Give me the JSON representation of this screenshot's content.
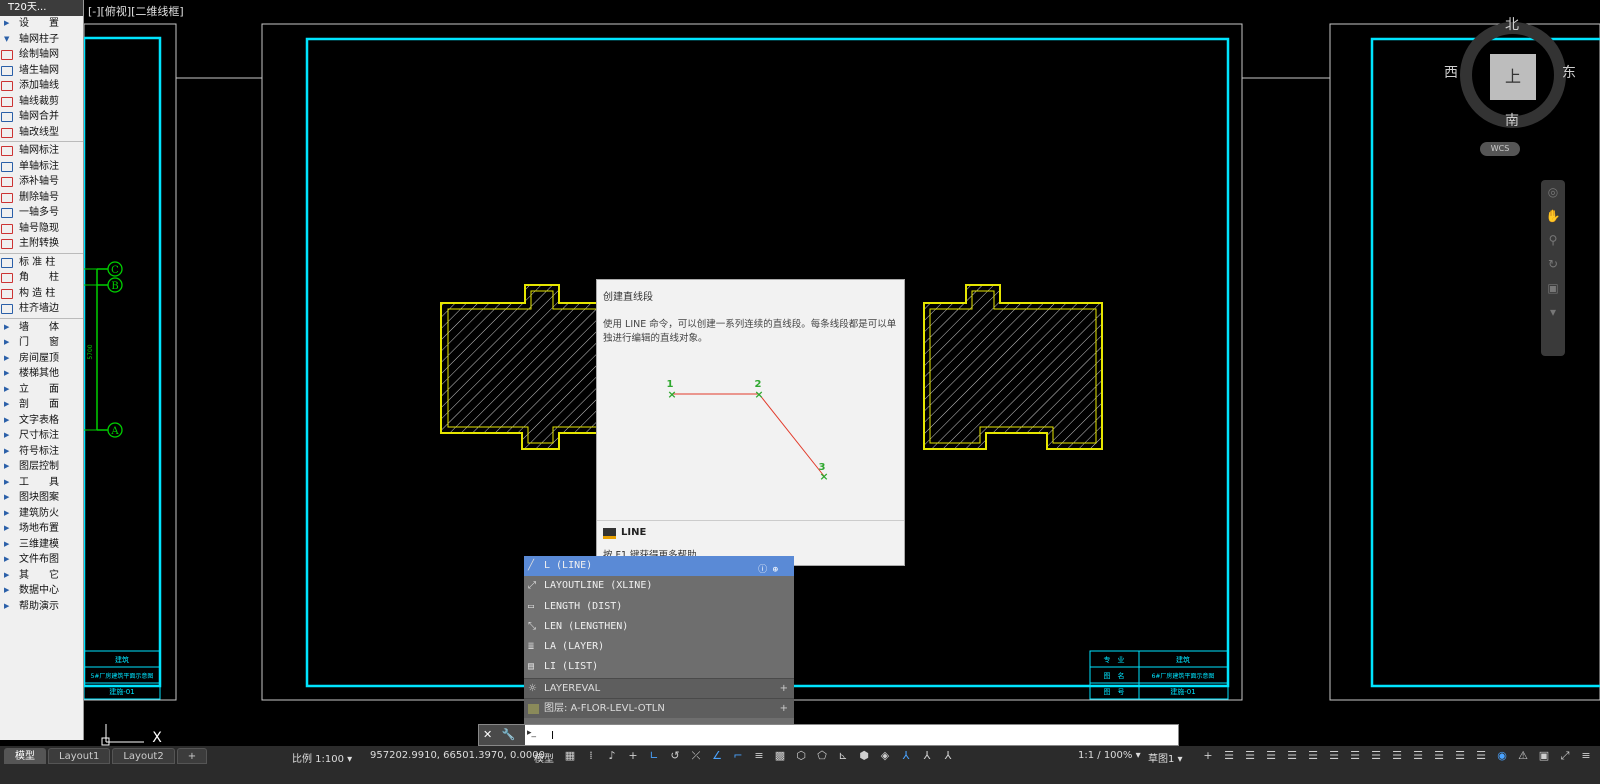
{
  "viewport": {
    "label": "[-][俯视][二维线框]"
  },
  "side_menu": {
    "title": "T20天...",
    "items": [
      {
        "label": "设　　置",
        "type": "group"
      },
      {
        "label": "轴网柱子",
        "type": "group-open"
      },
      {
        "label": "绘制轴网",
        "type": "sub"
      },
      {
        "label": "墙生轴网",
        "type": "sub"
      },
      {
        "label": "添加轴线",
        "type": "sub"
      },
      {
        "label": "轴线裁剪",
        "type": "sub"
      },
      {
        "label": "轴网合并",
        "type": "sub"
      },
      {
        "label": "轴改线型",
        "type": "sub"
      },
      {
        "label": "轴网标注",
        "type": "sub"
      },
      {
        "label": "单轴标注",
        "type": "sub"
      },
      {
        "label": "添补轴号",
        "type": "sub"
      },
      {
        "label": "删除轴号",
        "type": "sub"
      },
      {
        "label": "一轴多号",
        "type": "sub"
      },
      {
        "label": "轴号隐现",
        "type": "sub"
      },
      {
        "label": "主附转换",
        "type": "sub"
      },
      {
        "label": "标 准 柱",
        "type": "sub"
      },
      {
        "label": "角　　柱",
        "type": "sub"
      },
      {
        "label": "构 造 柱",
        "type": "sub"
      },
      {
        "label": "柱齐墙边",
        "type": "sub"
      },
      {
        "label": "墙　　体",
        "type": "group"
      },
      {
        "label": "门　　窗",
        "type": "group"
      },
      {
        "label": "房间屋顶",
        "type": "group"
      },
      {
        "label": "楼梯其他",
        "type": "group"
      },
      {
        "label": "立　　面",
        "type": "group"
      },
      {
        "label": "剖　　面",
        "type": "group"
      },
      {
        "label": "文字表格",
        "type": "group"
      },
      {
        "label": "尺寸标注",
        "type": "group"
      },
      {
        "label": "符号标注",
        "type": "group"
      },
      {
        "label": "图层控制",
        "type": "group"
      },
      {
        "label": "工　　具",
        "type": "group"
      },
      {
        "label": "图块图案",
        "type": "group"
      },
      {
        "label": "建筑防火",
        "type": "group"
      },
      {
        "label": "场地布置",
        "type": "group"
      },
      {
        "label": "三维建模",
        "type": "group"
      },
      {
        "label": "文件布图",
        "type": "group"
      },
      {
        "label": "其　　它",
        "type": "group"
      },
      {
        "label": "数据中心",
        "type": "group"
      },
      {
        "label": "帮助演示",
        "type": "group"
      }
    ]
  },
  "drawing": {
    "axis_labels": [
      "C",
      "B",
      "A"
    ],
    "dimension_text": "5700",
    "title_block_right": {
      "rows": [
        [
          "专　业",
          "建筑"
        ],
        [
          "图　名",
          "6#厂房建筑平面示意图"
        ],
        [
          "图　号",
          "建施-01"
        ]
      ]
    },
    "title_block_left": {
      "rows": [
        "建筑",
        "5#厂房建筑平面示意图",
        "建施-01"
      ]
    },
    "ucs_label": "X"
  },
  "tooltip": {
    "title": "创建直线段",
    "description": "使用 LINE 命令，可以创建一系列连续的直线段。每条线段都是可以单独进行编辑的直线对象。",
    "points": [
      "1",
      "2",
      "3"
    ],
    "command": "LINE",
    "help": "按 F1 键获得更多帮助"
  },
  "autocomplete": {
    "items": [
      {
        "label": "L (LINE)",
        "selected": true
      },
      {
        "label": "LAYOUTLINE (XLINE)",
        "selected": false
      },
      {
        "label": "LENGTH (DIST)",
        "selected": false
      },
      {
        "label": "LEN (LENGTHEN)",
        "selected": false
      },
      {
        "label": "LA (LAYER)",
        "selected": false
      },
      {
        "label": "LI (LIST)",
        "selected": false
      }
    ],
    "groups": [
      {
        "label": "LAYEREVAL"
      },
      {
        "label": "图层: A-FLOR-LEVL-OTLN"
      }
    ]
  },
  "command_line": {
    "value": "l"
  },
  "viewcube": {
    "north": "北",
    "south": "南",
    "east": "东",
    "west": "西",
    "face": "上",
    "wcs": "WCS"
  },
  "status_bar": {
    "tabs": [
      {
        "label": "模型",
        "active": true
      },
      {
        "label": "Layout1",
        "active": false
      },
      {
        "label": "Layout2",
        "active": false
      },
      {
        "label": "+",
        "active": false
      }
    ],
    "scale": "比例 1:100 ▾",
    "coordinates": "957202.9910, 66501.3970, 0.0000",
    "model_label": "模型",
    "annotation_scale": "1:1 / 100% ▾",
    "workspace": "草图1 ▾"
  },
  "colors": {
    "frame_cyan": "#00e5ff",
    "frame_gray": "#c8c8c8",
    "wall_yellow": "#e6e600",
    "axis_green": "#00d000",
    "line_red": "#e23a2a",
    "point_green": "#2fa82f",
    "selected_blue": "#5a8ad6"
  }
}
